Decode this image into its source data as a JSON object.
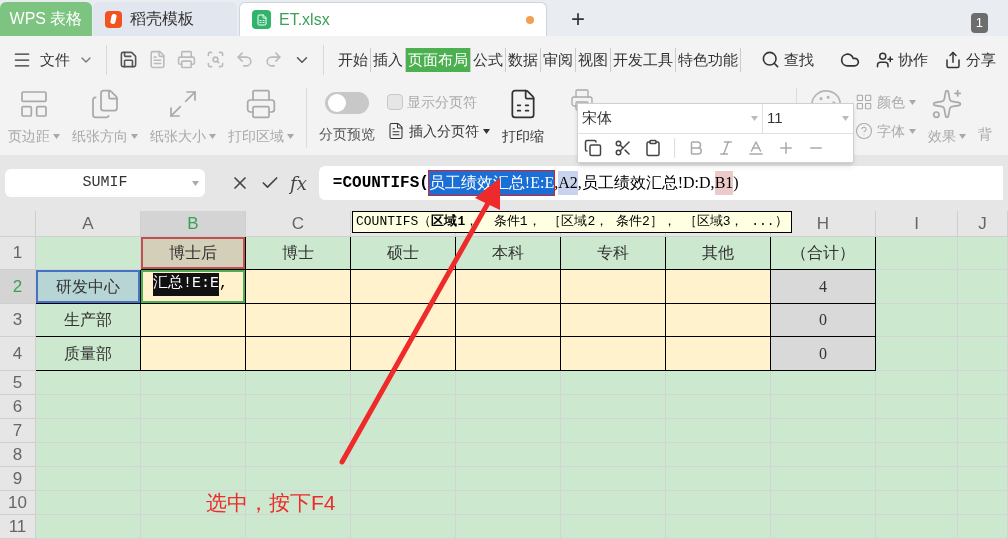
{
  "tabs": [
    {
      "kind": "app",
      "label": "WPS 表格",
      "selected": false
    },
    {
      "kind": "docer",
      "label": "稻壳模板",
      "selected": false
    },
    {
      "kind": "file",
      "label": "ET.xlsx",
      "selected": true,
      "modified": true
    }
  ],
  "new_tab": "+",
  "window_count": "1",
  "menu": {
    "file": "文件",
    "tabs": [
      {
        "label": "开始",
        "selected": false
      },
      {
        "label": "插入",
        "selected": false
      },
      {
        "label": "页面布局",
        "selected": true
      },
      {
        "label": "公式",
        "selected": false
      },
      {
        "label": "数据",
        "selected": false
      },
      {
        "label": "审阅",
        "selected": false
      },
      {
        "label": "视图",
        "selected": false
      },
      {
        "label": "开发工具",
        "selected": false
      },
      {
        "label": "特色功能",
        "selected": false
      }
    ],
    "search": "查找",
    "actions": [
      {
        "kind": "collab",
        "label": "协作"
      },
      {
        "kind": "share",
        "label": "分享"
      }
    ]
  },
  "ribbon": {
    "items": [
      {
        "kind": "large",
        "label": "页边距",
        "dropdown": true,
        "disabled": true
      },
      {
        "kind": "large",
        "label": "纸张方向",
        "dropdown": true,
        "disabled": true
      },
      {
        "kind": "large",
        "label": "纸张大小",
        "dropdown": true,
        "disabled": true
      },
      {
        "kind": "large",
        "label": "打印区域",
        "dropdown": true,
        "disabled": true
      },
      {
        "kind": "toggle",
        "label": "分页预览",
        "on": false
      },
      {
        "kind": "stack",
        "items": [
          {
            "kind": "check",
            "label": "显示分页符",
            "checked": false,
            "disabled": true
          },
          {
            "kind": "small",
            "label": "插入分页符",
            "dropdown": true,
            "disabled": false
          }
        ]
      },
      {
        "kind": "large",
        "label": "打印缩",
        "disabled": false
      },
      {
        "kind": "stack",
        "items": [
          {
            "kind": "small",
            "label": "颜色",
            "dropdown": true,
            "disabled": true
          },
          {
            "kind": "small",
            "label": "字体",
            "dropdown": true,
            "disabled": true
          }
        ]
      },
      {
        "kind": "large",
        "label": "效果",
        "dropdown": true,
        "disabled": true
      },
      {
        "kind": "cut",
        "label": "背",
        "disabled": true
      }
    ]
  },
  "mini_toolbar": {
    "font": "宋体",
    "size": "11"
  },
  "formula_bar": {
    "name_box": "SUMIF",
    "function_label": "fx",
    "parts": [
      {
        "kind": "function",
        "text": "=COUNTIFS("
      },
      {
        "kind": "selected",
        "text": "员工绩效汇总!E:E"
      },
      {
        "kind": "plain",
        "text": ","
      },
      {
        "kind": "ref",
        "text": "A2",
        "color": "#c8d4ee"
      },
      {
        "kind": "plain",
        "text": ",员工绩效汇总!D:D,"
      },
      {
        "kind": "ref",
        "text": "B1",
        "color": "#eccaca"
      },
      {
        "kind": "plain",
        "text": ")"
      }
    ]
  },
  "tooltip": "COUNTIFS（**区域1**，  条件1， ［区域2， 条件2］， ［区域3， ...）",
  "sheet": {
    "columns": [
      {
        "label": "A",
        "selected": false
      },
      {
        "label": "B",
        "selected": true
      },
      {
        "label": "C",
        "selected": false
      },
      {
        "selected": false
      },
      {
        "selected": false
      },
      {
        "selected": false
      },
      {
        "selected": false
      },
      {
        "label": "H",
        "selected": false
      },
      {
        "label": "I",
        "selected": false
      },
      {
        "label": "J",
        "selected": false
      }
    ],
    "rows": [
      {
        "label": "1",
        "selected": false,
        "cells": [
          {
            "kind": "head"
          },
          {
            "kind": "head",
            "text": "博士后",
            "color": "#c0504d"
          },
          {
            "kind": "head",
            "text": "博士"
          },
          {
            "kind": "head",
            "text": "硕士"
          },
          {
            "kind": "head",
            "text": "本科"
          },
          {
            "kind": "head",
            "text": "专科"
          },
          {
            "kind": "head",
            "text": "其他"
          },
          {
            "kind": "head",
            "text": "（合计）"
          },
          {
            "kind": "none"
          },
          {
            "kind": "none"
          }
        ]
      },
      {
        "label": "2",
        "selected": true,
        "cells": [
          {
            "kind": "label",
            "text": "研发中心",
            "color": "#4472c4"
          },
          {
            "kind": "editing",
            "parts": [
              {
                "kind": "selected",
                "text": "汇总!E:E"
              },
              {
                "kind": "plain",
                "text": ","
              }
            ]
          },
          {
            "kind": "input"
          },
          {
            "kind": "input"
          },
          {
            "kind": "input"
          },
          {
            "kind": "input"
          },
          {
            "kind": "input"
          },
          {
            "kind": "total",
            "text": "4"
          },
          {
            "kind": "none"
          },
          {
            "kind": "none"
          }
        ]
      },
      {
        "label": "3",
        "selected": false,
        "cells": [
          {
            "kind": "label",
            "text": "生产部"
          },
          {
            "kind": "input"
          },
          {
            "kind": "input"
          },
          {
            "kind": "input"
          },
          {
            "kind": "input"
          },
          {
            "kind": "input"
          },
          {
            "kind": "input"
          },
          {
            "kind": "total",
            "text": "0"
          },
          {
            "kind": "none"
          },
          {
            "kind": "none"
          }
        ]
      },
      {
        "label": "4",
        "selected": false,
        "cells": [
          {
            "kind": "label",
            "text": "质量部"
          },
          {
            "kind": "input"
          },
          {
            "kind": "input"
          },
          {
            "kind": "input"
          },
          {
            "kind": "input"
          },
          {
            "kind": "input"
          },
          {
            "kind": "input"
          },
          {
            "kind": "total",
            "text": "0"
          },
          {
            "kind": "none"
          },
          {
            "kind": "none"
          }
        ]
      },
      {
        "label": "5",
        "selected": false
      },
      {
        "label": "6",
        "selected": false
      },
      {
        "label": "7",
        "selected": false
      },
      {
        "label": "8",
        "selected": false
      },
      {
        "label": "9",
        "selected": false
      },
      {
        "label": "10",
        "selected": false
      },
      {
        "label": "11",
        "selected": false
      }
    ]
  },
  "annotation": "选中，按下F4"
}
